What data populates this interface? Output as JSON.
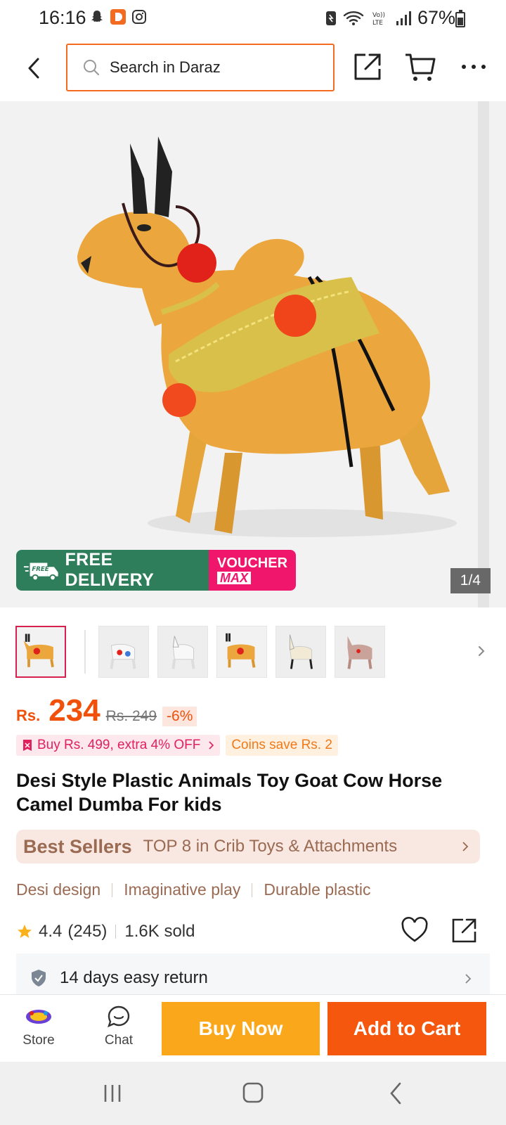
{
  "status_bar": {
    "time": "16:16",
    "battery": "67%",
    "icons": [
      "snapchat-icon",
      "daraz-icon",
      "instagram-icon",
      "nfc-icon",
      "wifi-icon",
      "volte-icon",
      "signal-icon",
      "battery-icon"
    ]
  },
  "header": {
    "search_placeholder": "Search in Daraz",
    "icons": [
      "back-icon",
      "search-icon",
      "share-icon",
      "cart-icon",
      "more-icon"
    ]
  },
  "gallery": {
    "counter": "1/4",
    "badge_free_label": "FREE DELIVERY",
    "badge_free_small": "FREE",
    "badge_voucher_line1": "VOUCHER",
    "badge_voucher_line2": "MAX",
    "thumbnails": [
      "cow",
      "white-horse-1",
      "white-horse-2",
      "cow-2",
      "llama",
      "pink-horse"
    ]
  },
  "price": {
    "currency": "Rs.",
    "value": "234",
    "original": "Rs. 249",
    "discount": "-6%"
  },
  "promos": {
    "bundle": "Buy Rs. 499, extra 4% OFF",
    "coins": "Coins save Rs. 2"
  },
  "product": {
    "title": "Desi Style Plastic Animals Toy Goat Cow Horse Camel Dumba For kids"
  },
  "best_sellers": {
    "logo": "Best Sellers",
    "text": "TOP 8 in Crib Toys & Attachments"
  },
  "features": [
    "Desi design",
    "Imaginative play",
    "Durable plastic"
  ],
  "rating": {
    "score": "4.4",
    "count": "(245)",
    "sold": "1.6K sold"
  },
  "return_policy": {
    "text": "14 days easy return"
  },
  "action_bar": {
    "store_label": "Store",
    "chat_label": "Chat",
    "buy_now": "Buy Now",
    "add_to_cart": "Add to Cart"
  },
  "colors": {
    "accent_orange": "#f5570e",
    "buy_now_yellow": "#fba71c",
    "free_delivery_green": "#2e7d5b",
    "voucher_pink": "#f0166b"
  }
}
